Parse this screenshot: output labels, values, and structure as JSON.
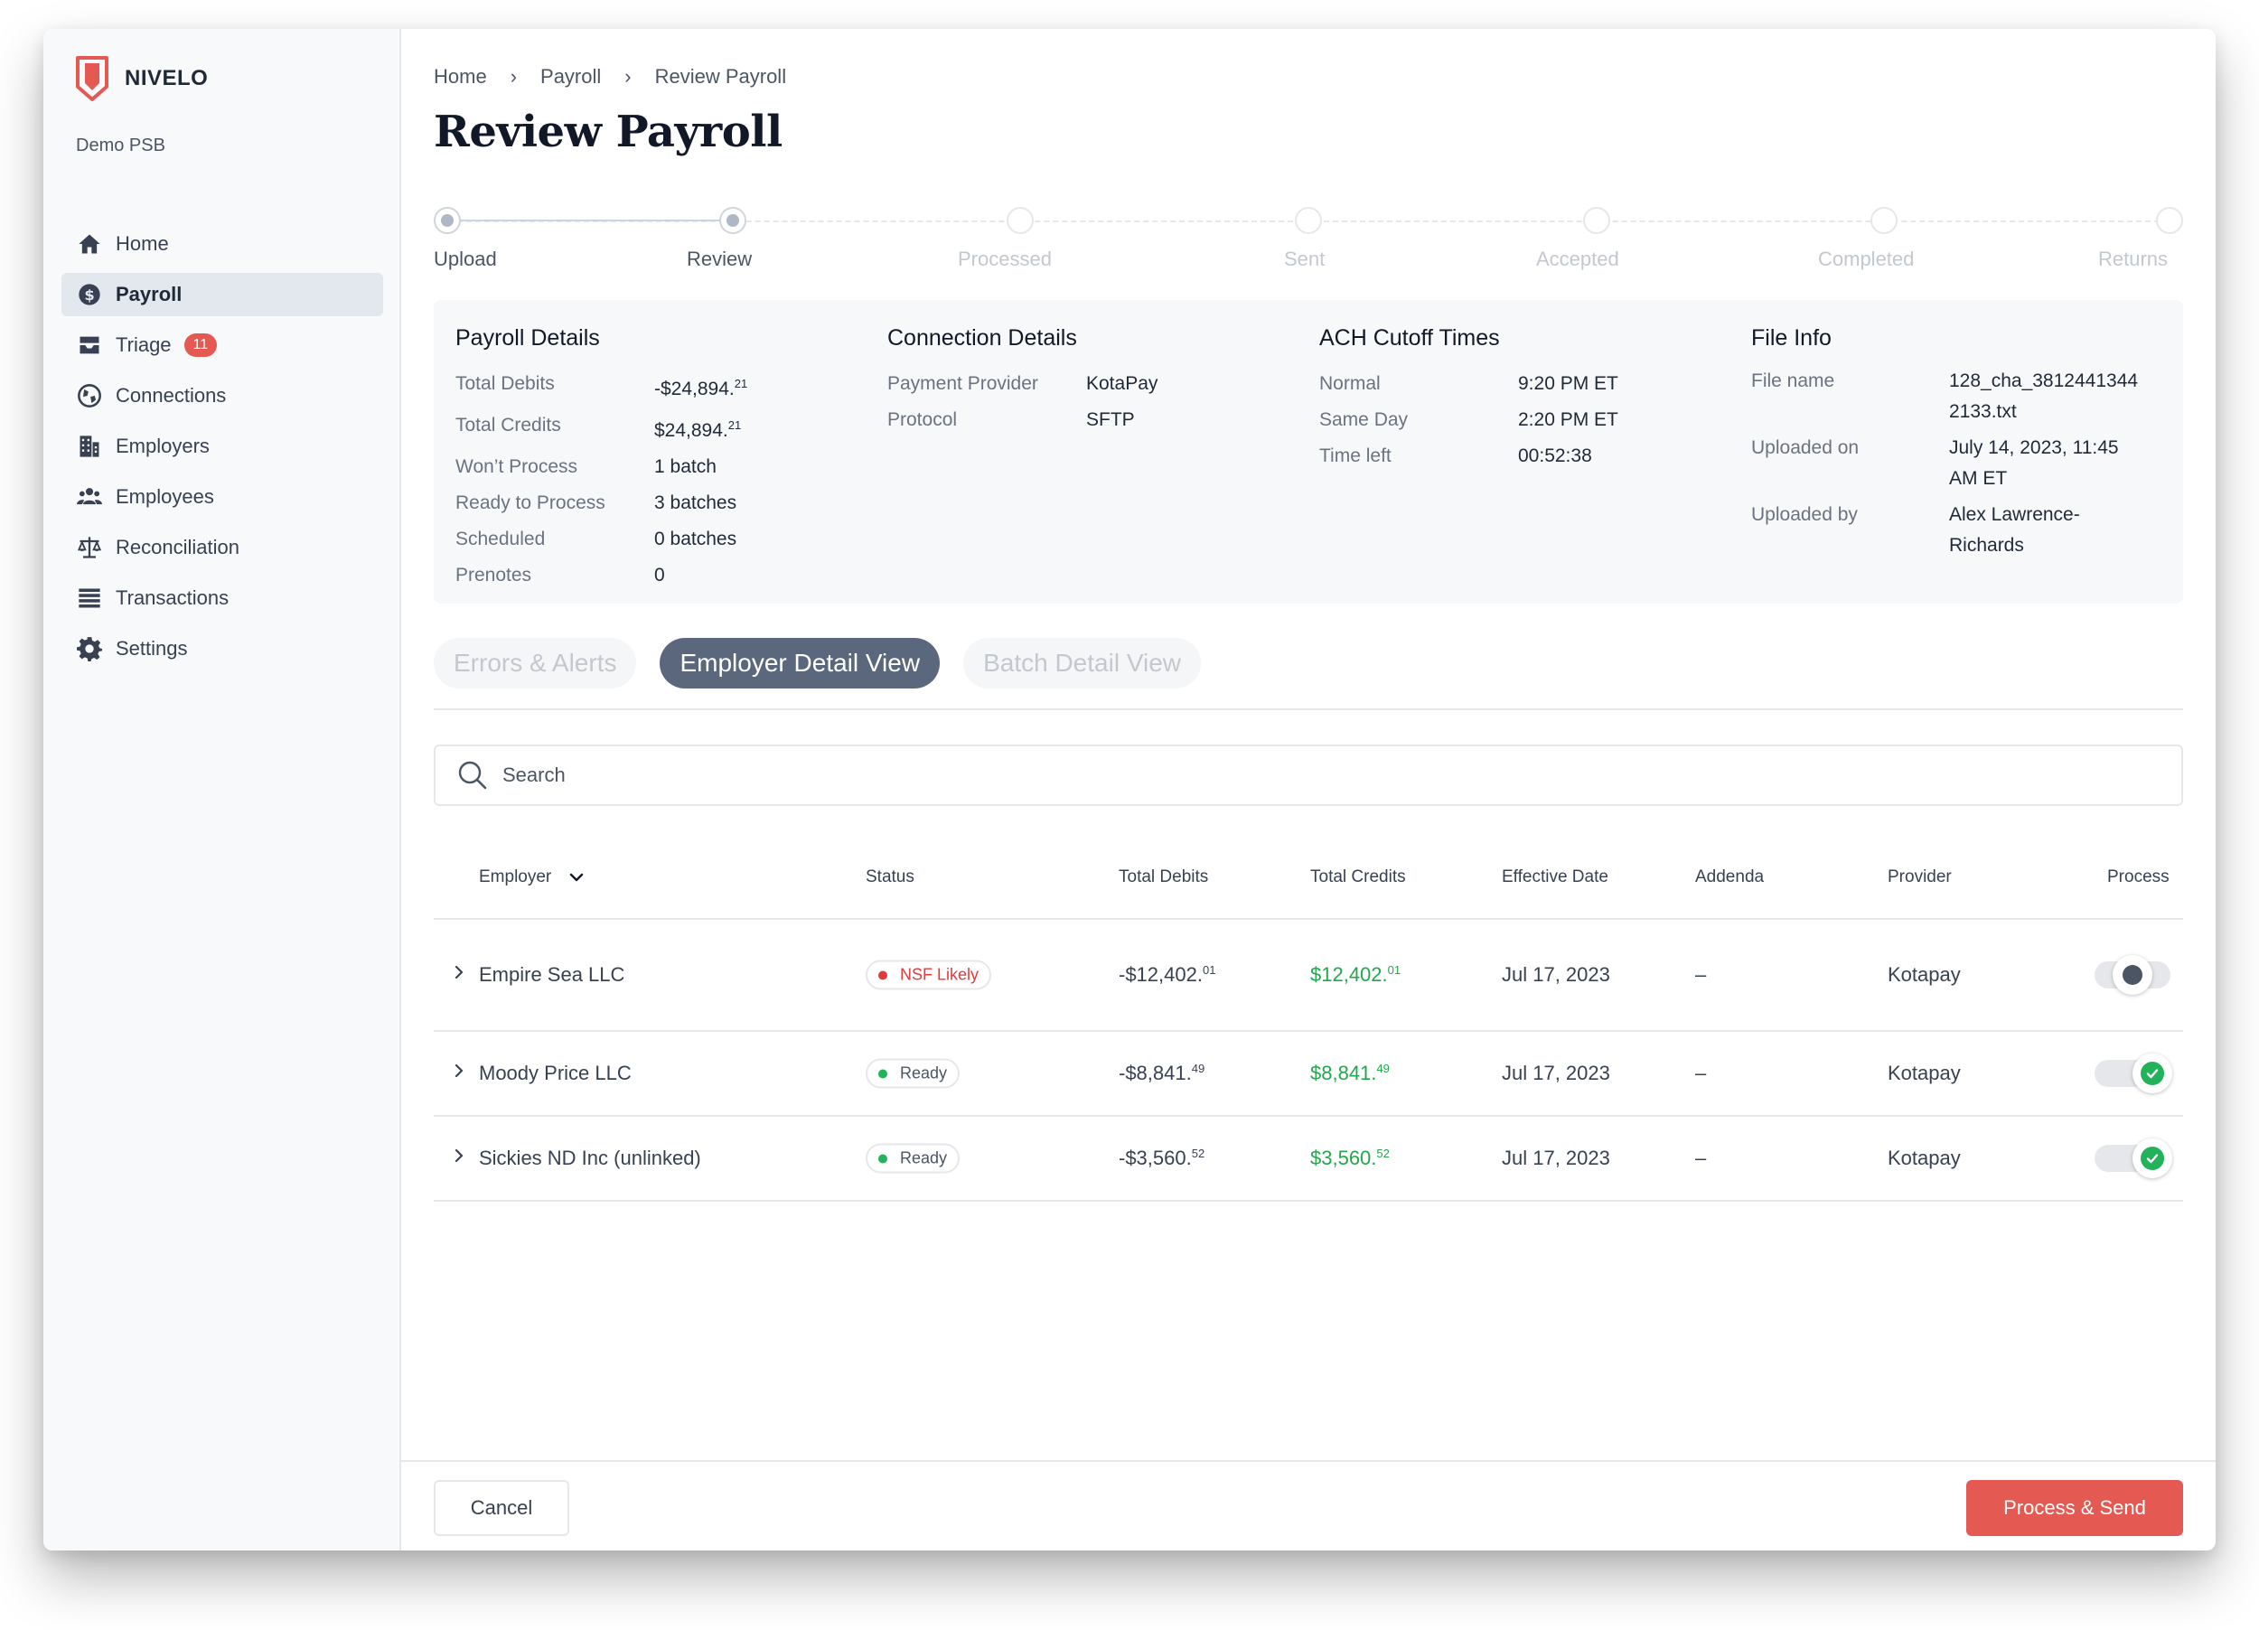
{
  "app": {
    "brand": "NIVELO",
    "org": "Demo PSB",
    "brand_color": "#e45a53"
  },
  "sidebar": {
    "items": [
      {
        "label": "Home",
        "icon": "home-icon"
      },
      {
        "label": "Payroll",
        "icon": "dollar-circle-icon",
        "active": true
      },
      {
        "label": "Triage",
        "icon": "inbox-tray-icon",
        "badge": "11"
      },
      {
        "label": "Connections",
        "icon": "globe-icon"
      },
      {
        "label": "Employers",
        "icon": "building-icon"
      },
      {
        "label": "Employees",
        "icon": "users-icon"
      },
      {
        "label": "Reconciliation",
        "icon": "scale-icon"
      },
      {
        "label": "Transactions",
        "icon": "list-icon"
      },
      {
        "label": "Settings",
        "icon": "gear-icon"
      }
    ]
  },
  "breadcrumb": [
    "Home",
    "Payroll",
    "Review Payroll"
  ],
  "page": {
    "title": "Review Payroll"
  },
  "stepper": {
    "steps": [
      {
        "label": "Upload",
        "state": "done"
      },
      {
        "label": "Review",
        "state": "current"
      },
      {
        "label": "Processed",
        "state": "todo"
      },
      {
        "label": "Sent",
        "state": "todo"
      },
      {
        "label": "Accepted",
        "state": "todo"
      },
      {
        "label": "Completed",
        "state": "todo"
      },
      {
        "label": "Returns",
        "state": "todo"
      }
    ]
  },
  "details": {
    "payroll": {
      "title": "Payroll Details",
      "total_debits_label": "Total Debits",
      "total_debits_main": "-$24,894.",
      "total_debits_cents": "21",
      "total_credits_label": "Total Credits",
      "total_credits_main": "$24,894.",
      "total_credits_cents": "21",
      "wont_process_label": "Won’t Process",
      "wont_process_value": "1 batch",
      "ready_label": "Ready to Process",
      "ready_value": "3 batches",
      "scheduled_label": "Scheduled",
      "scheduled_value": "0 batches",
      "prenotes_label": "Prenotes",
      "prenotes_value": "0"
    },
    "connection": {
      "title": "Connection Details",
      "provider_label": "Payment Provider",
      "provider_value": "KotaPay",
      "protocol_label": "Protocol",
      "protocol_value": "SFTP"
    },
    "ach": {
      "title": "ACH Cutoff Times",
      "normal_label": "Normal",
      "normal_value": "9:20 PM ET",
      "same_day_label": "Same Day",
      "same_day_value": "2:20 PM ET",
      "time_left_label": "Time left",
      "time_left_value": "00:52:38"
    },
    "file": {
      "title": "File Info",
      "name_label": "File name",
      "name_line1": "128_cha_3812441344",
      "name_line2": "2133.txt",
      "uploaded_on_label": "Uploaded on",
      "uploaded_on_line1": "July 14, 2023, 11:45",
      "uploaded_on_line2": "AM ET",
      "uploaded_by_label": "Uploaded by",
      "uploaded_by_line1": "Alex Lawrence-",
      "uploaded_by_line2": "Richards"
    }
  },
  "tabs": [
    {
      "label": "Errors & Alerts",
      "active": false
    },
    {
      "label": "Employer Detail View",
      "active": true
    },
    {
      "label": "Batch Detail View",
      "active": false
    }
  ],
  "search": {
    "placeholder": "Search"
  },
  "table": {
    "columns": [
      "Employer",
      "Status",
      "Total Debits",
      "Total Credits",
      "Effective Date",
      "Addenda",
      "Provider",
      "Process"
    ],
    "rows": [
      {
        "employer": "Empire Sea LLC",
        "status": "NSF Likely",
        "debit_main": "-$12,402.",
        "debit_cents": "01",
        "credit_main": "$12,402.",
        "credit_cents": "01",
        "date": "Jul 17, 2023",
        "addenda": "–",
        "provider": "Kotapay",
        "process": false
      },
      {
        "employer": "Moody Price LLC",
        "status": "Ready",
        "debit_main": "-$8,841.",
        "debit_cents": "49",
        "credit_main": "$8,841.",
        "credit_cents": "49",
        "date": "Jul 17, 2023",
        "addenda": "–",
        "provider": "Kotapay",
        "process": true
      },
      {
        "employer": "Sickies ND Inc (unlinked)",
        "status": "Ready",
        "debit_main": "-$3,560.",
        "debit_cents": "52",
        "credit_main": "$3,560.",
        "credit_cents": "52",
        "date": "Jul 17, 2023",
        "addenda": "–",
        "provider": "Kotapay",
        "process": true
      }
    ]
  },
  "footer": {
    "cancel_label": "Cancel",
    "primary_label": "Process & Send"
  }
}
